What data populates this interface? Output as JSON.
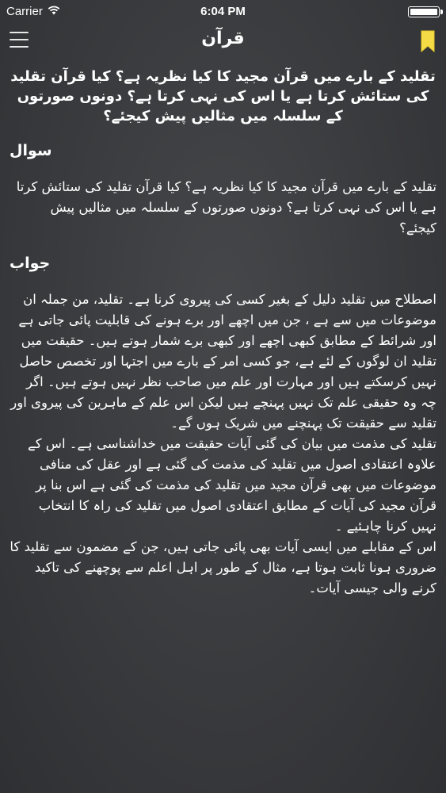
{
  "status_bar": {
    "carrier": "Carrier",
    "time": "6:04 PM",
    "battery_level": 1.0,
    "wifi_icon": "wifi-icon",
    "battery_icon": "battery-icon"
  },
  "nav": {
    "title": "قرآن",
    "menu_icon": "hamburger-menu-icon",
    "bookmark_icon": "bookmark-icon",
    "bookmark_color": "#f5dc46"
  },
  "article": {
    "question_heading": "تقلید کے بارے میں قرآن مجید کا کیا نظریہ ہے؟ کیا قرآن تقلید کی ستائش کرتا ہے یا اس کی نہی کرتا ہے؟ دونوں صورتوں کے سلسلہ میں مثالیں پیش کیجئے؟",
    "question_label": "سوال",
    "question_text": "تقلید کے بارے میں قرآن مجید کا کیا نظریہ ہے؟ کیا قرآن تقلید کی ستائش کرتا ہے یا اس کی نہی کرتا ہے؟ دونوں صورتوں کے سلسلہ میں مثالیں پیش کیجئے؟",
    "answer_label": "جواب",
    "answer_paragraphs": [
      "اصطلاح میں تقلید دلیل کے بغیر کسی کی پیروی کرنا ہے۔ تقلید، من جملہ ان موضوعات میں سے ہے ، جن میں اچھے اور برے ہونے کی قابلیت پائی جاتی ہے اور شرائط کے مطابق کبھی اچھے اور کبھی برے شمار ہوتے ہیں۔ حقیقت میں تقلید ان لوگوں کے لئے ہے، جو کسی امر کے بارے میں اجتہا اور تخصص حاصل نہیں کرسکتے ہیں اور مہارت اور علم میں صاحب نظر نہیں ہوتے ہیں۔ اگر چہ وہ حقیقی علم تک نہیں پہنچے ہیں لیکن اس علم کے ماہرین کی پیروی اور تقلید سے حقیقت تک پہنچنے میں شریک ہوں گے۔",
      "تقلید کی مذمت میں بیان کی گئی آیات حقیقت میں خداشناسی ہے۔ اس کے علاوہ اعتقادی اصول میں تقلید کی مذمت کی گئی ہے اور عقل کی منافی موضوعات میں بھی قرآن مجید میں تقلید کی مذمت کی گئی ہے اس بنا پر قرآن مجید کی آیات کے مطابق اعتقادی اصول میں تقلید کی راہ کا انتخاب نہیں کرنا چاہئیے ۔",
      "اس کے مقابلے میں ایسی آیات بھی پائی جاتی ہیں، جن کے مضمون سے تقلید کا ضروری ہونا ثابت ہوتا ہے، مثال کے طور پر اہل اعلم سے پوچھنے کی تاکید کرنے والی جیسی آیات۔"
    ]
  }
}
